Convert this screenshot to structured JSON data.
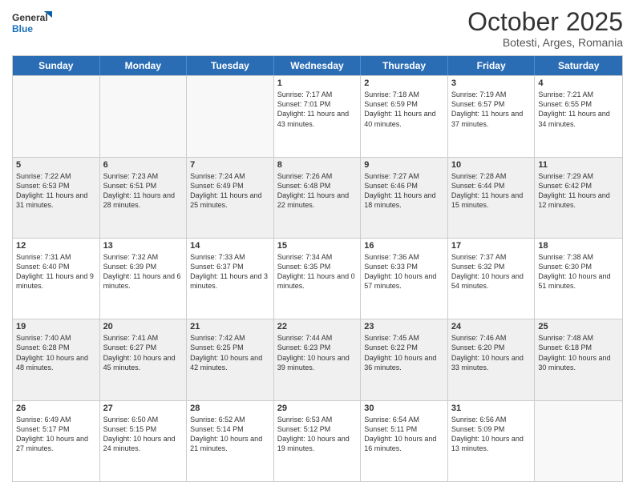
{
  "header": {
    "logo_general": "General",
    "logo_blue": "Blue",
    "title": "October 2025",
    "subtitle": "Botesti, Arges, Romania"
  },
  "days_of_week": [
    "Sunday",
    "Monday",
    "Tuesday",
    "Wednesday",
    "Thursday",
    "Friday",
    "Saturday"
  ],
  "weeks": [
    [
      {
        "day": "",
        "empty": true
      },
      {
        "day": "",
        "empty": true
      },
      {
        "day": "",
        "empty": true
      },
      {
        "day": "1",
        "sunrise": "7:17 AM",
        "sunset": "7:01 PM",
        "daylight": "11 hours and 43 minutes."
      },
      {
        "day": "2",
        "sunrise": "7:18 AM",
        "sunset": "6:59 PM",
        "daylight": "11 hours and 40 minutes."
      },
      {
        "day": "3",
        "sunrise": "7:19 AM",
        "sunset": "6:57 PM",
        "daylight": "11 hours and 37 minutes."
      },
      {
        "day": "4",
        "sunrise": "7:21 AM",
        "sunset": "6:55 PM",
        "daylight": "11 hours and 34 minutes."
      }
    ],
    [
      {
        "day": "5",
        "sunrise": "7:22 AM",
        "sunset": "6:53 PM",
        "daylight": "11 hours and 31 minutes."
      },
      {
        "day": "6",
        "sunrise": "7:23 AM",
        "sunset": "6:51 PM",
        "daylight": "11 hours and 28 minutes."
      },
      {
        "day": "7",
        "sunrise": "7:24 AM",
        "sunset": "6:49 PM",
        "daylight": "11 hours and 25 minutes."
      },
      {
        "day": "8",
        "sunrise": "7:26 AM",
        "sunset": "6:48 PM",
        "daylight": "11 hours and 22 minutes."
      },
      {
        "day": "9",
        "sunrise": "7:27 AM",
        "sunset": "6:46 PM",
        "daylight": "11 hours and 18 minutes."
      },
      {
        "day": "10",
        "sunrise": "7:28 AM",
        "sunset": "6:44 PM",
        "daylight": "11 hours and 15 minutes."
      },
      {
        "day": "11",
        "sunrise": "7:29 AM",
        "sunset": "6:42 PM",
        "daylight": "11 hours and 12 minutes."
      }
    ],
    [
      {
        "day": "12",
        "sunrise": "7:31 AM",
        "sunset": "6:40 PM",
        "daylight": "11 hours and 9 minutes."
      },
      {
        "day": "13",
        "sunrise": "7:32 AM",
        "sunset": "6:39 PM",
        "daylight": "11 hours and 6 minutes."
      },
      {
        "day": "14",
        "sunrise": "7:33 AM",
        "sunset": "6:37 PM",
        "daylight": "11 hours and 3 minutes."
      },
      {
        "day": "15",
        "sunrise": "7:34 AM",
        "sunset": "6:35 PM",
        "daylight": "11 hours and 0 minutes."
      },
      {
        "day": "16",
        "sunrise": "7:36 AM",
        "sunset": "6:33 PM",
        "daylight": "10 hours and 57 minutes."
      },
      {
        "day": "17",
        "sunrise": "7:37 AM",
        "sunset": "6:32 PM",
        "daylight": "10 hours and 54 minutes."
      },
      {
        "day": "18",
        "sunrise": "7:38 AM",
        "sunset": "6:30 PM",
        "daylight": "10 hours and 51 minutes."
      }
    ],
    [
      {
        "day": "19",
        "sunrise": "7:40 AM",
        "sunset": "6:28 PM",
        "daylight": "10 hours and 48 minutes."
      },
      {
        "day": "20",
        "sunrise": "7:41 AM",
        "sunset": "6:27 PM",
        "daylight": "10 hours and 45 minutes."
      },
      {
        "day": "21",
        "sunrise": "7:42 AM",
        "sunset": "6:25 PM",
        "daylight": "10 hours and 42 minutes."
      },
      {
        "day": "22",
        "sunrise": "7:44 AM",
        "sunset": "6:23 PM",
        "daylight": "10 hours and 39 minutes."
      },
      {
        "day": "23",
        "sunrise": "7:45 AM",
        "sunset": "6:22 PM",
        "daylight": "10 hours and 36 minutes."
      },
      {
        "day": "24",
        "sunrise": "7:46 AM",
        "sunset": "6:20 PM",
        "daylight": "10 hours and 33 minutes."
      },
      {
        "day": "25",
        "sunrise": "7:48 AM",
        "sunset": "6:18 PM",
        "daylight": "10 hours and 30 minutes."
      }
    ],
    [
      {
        "day": "26",
        "sunrise": "6:49 AM",
        "sunset": "5:17 PM",
        "daylight": "10 hours and 27 minutes."
      },
      {
        "day": "27",
        "sunrise": "6:50 AM",
        "sunset": "5:15 PM",
        "daylight": "10 hours and 24 minutes."
      },
      {
        "day": "28",
        "sunrise": "6:52 AM",
        "sunset": "5:14 PM",
        "daylight": "10 hours and 21 minutes."
      },
      {
        "day": "29",
        "sunrise": "6:53 AM",
        "sunset": "5:12 PM",
        "daylight": "10 hours and 19 minutes."
      },
      {
        "day": "30",
        "sunrise": "6:54 AM",
        "sunset": "5:11 PM",
        "daylight": "10 hours and 16 minutes."
      },
      {
        "day": "31",
        "sunrise": "6:56 AM",
        "sunset": "5:09 PM",
        "daylight": "10 hours and 13 minutes."
      },
      {
        "day": "",
        "empty": true
      }
    ]
  ]
}
